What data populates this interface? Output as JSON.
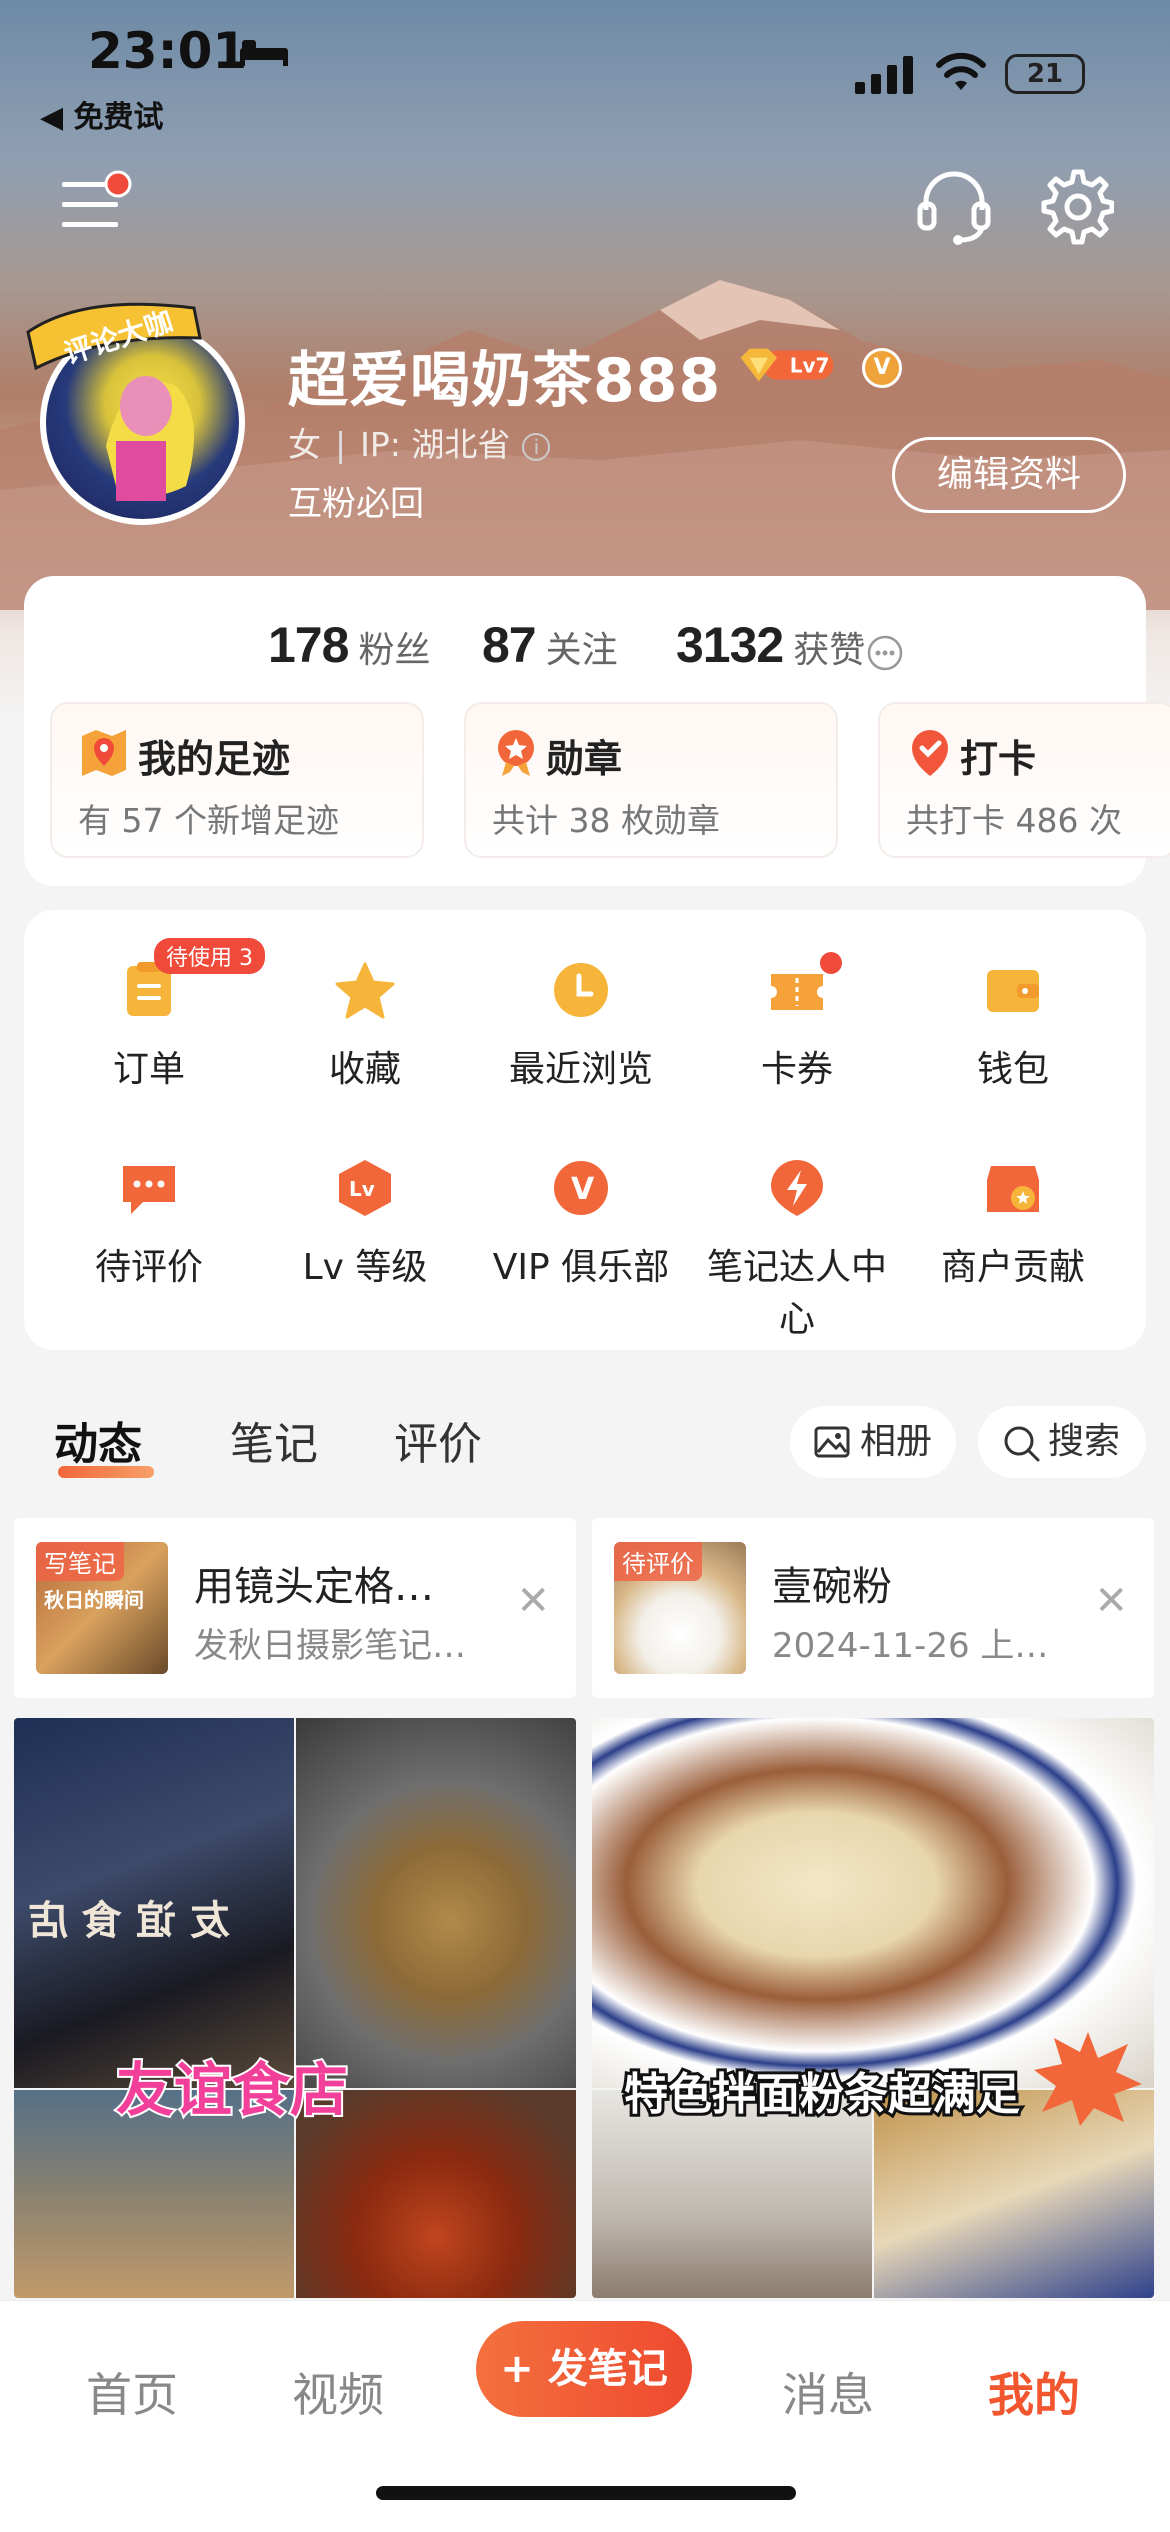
{
  "status_bar": {
    "time": "23:01",
    "back_label": "◀ 免费试",
    "battery": "21"
  },
  "profile": {
    "username": "超爱喝奶茶888",
    "level": "Lv7",
    "vip_badge": "V",
    "gender": "女",
    "ip": "IP: 湖北省",
    "motto": "互粉必回",
    "edit_button": "编辑资料",
    "avatar_badge_text": "评论大咖"
  },
  "stats": [
    {
      "value": "178",
      "label": "粉丝"
    },
    {
      "value": "87",
      "label": "关注"
    },
    {
      "value": "3132",
      "label": "获赞"
    }
  ],
  "tiles": [
    {
      "title": "我的足迹",
      "sub": "有 57 个新增足迹"
    },
    {
      "title": "勋章",
      "sub": "共计 38 枚勋章"
    },
    {
      "title": "打卡",
      "sub": "共打卡 486 次"
    }
  ],
  "grid": [
    {
      "label": "订单",
      "icon": "order-icon",
      "pill": "待使用 3"
    },
    {
      "label": "收藏",
      "icon": "star-icon"
    },
    {
      "label": "最近浏览",
      "icon": "clock-icon"
    },
    {
      "label": "卡券",
      "icon": "ticket-icon"
    },
    {
      "label": "钱包",
      "icon": "wallet-icon"
    },
    {
      "label": "待评价",
      "icon": "comment-icon"
    },
    {
      "label": "Lv 等级",
      "icon": "level-icon",
      "glyph": "Lv"
    },
    {
      "label": "VIP 俱乐部",
      "icon": "vip-icon",
      "glyph": "V"
    },
    {
      "label": "笔记达人中心",
      "icon": "lightning-icon"
    },
    {
      "label": "商户贡献",
      "icon": "shop-icon"
    }
  ],
  "tabs": {
    "items": [
      "动态",
      "笔记",
      "评价"
    ],
    "album": "相册",
    "search": "搜索"
  },
  "drafts": [
    {
      "tag": "写笔记",
      "thumb_text": "秋日的瞬间",
      "title": "用镜头定格…",
      "sub": "发秋日摄影笔记…",
      "close": "✕"
    },
    {
      "tag": "待评价",
      "title": "壹碗粉",
      "sub": "2024-11-26 上…",
      "close": "✕"
    }
  ],
  "posts": [
    {
      "caption": "友谊食店",
      "sign_text": "友谊食店"
    },
    {
      "caption": "特色拌面粉条超满足"
    }
  ],
  "nav": {
    "home": "首页",
    "video": "视频",
    "post": "+ 发笔记",
    "messages": "消息",
    "me": "我的"
  },
  "colors": {
    "accent": "#f2562f",
    "orange": "#f6a23a",
    "red": "#f04a3a"
  }
}
